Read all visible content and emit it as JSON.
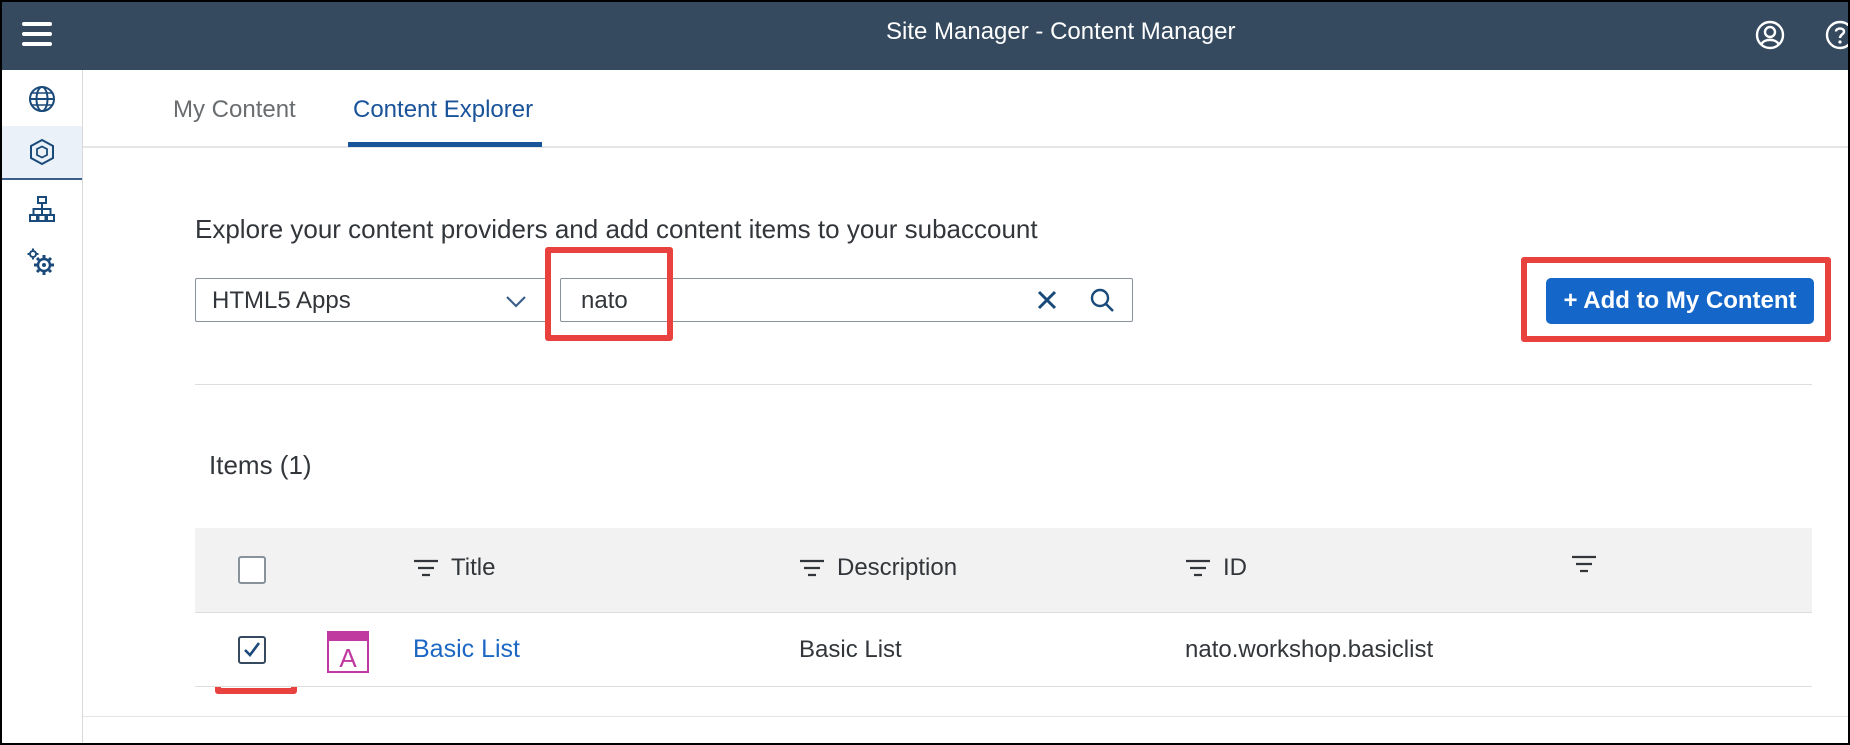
{
  "shell": {
    "title": "Site Manager - Content Manager",
    "menu_icon": "hamburger-menu-icon",
    "user_icon": "user-profile-icon",
    "help_icon": "help-icon",
    "bar_color": "#354a5f"
  },
  "sidenav": {
    "items": [
      {
        "icon": "globe-icon",
        "active": false
      },
      {
        "icon": "cube-icon",
        "active": true
      },
      {
        "icon": "hierarchy-icon",
        "active": false
      },
      {
        "icon": "settings-gears-icon",
        "active": false
      }
    ]
  },
  "tabs": [
    {
      "label": "My Content",
      "active": false
    },
    {
      "label": "Content Explorer",
      "active": true
    }
  ],
  "explorer": {
    "description": "Explore your content providers and add content items to your subaccount",
    "provider_select": {
      "value": "HTML5 Apps"
    },
    "search": {
      "value": "nato"
    },
    "add_button": {
      "label": "+ Add to My Content",
      "color": "#1467c9"
    }
  },
  "items": {
    "title": "Items  (1)",
    "columns": [
      "Title",
      "Description",
      "ID",
      ""
    ],
    "rows": [
      {
        "selected": true,
        "icon": "html5-app-icon",
        "title": "Basic List",
        "description": "Basic List",
        "id": "nato.workshop.basiclist"
      }
    ]
  },
  "highlight_color": "#e8413e"
}
